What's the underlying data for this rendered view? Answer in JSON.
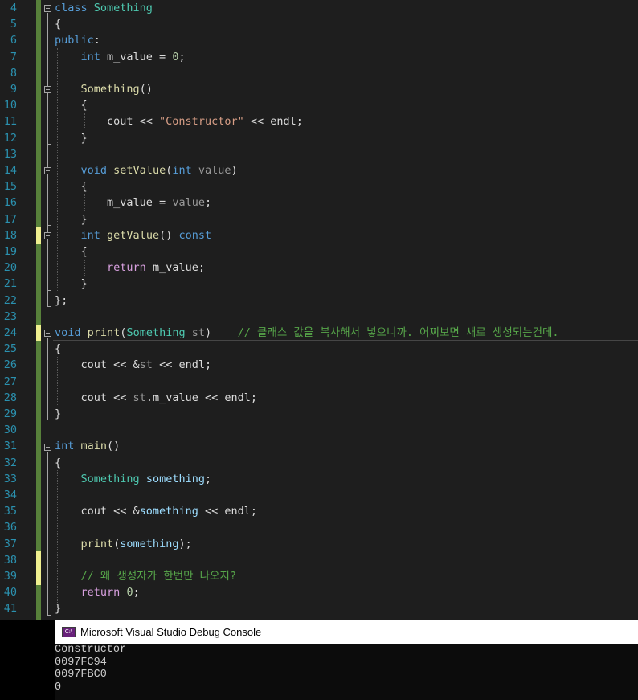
{
  "editor": {
    "line_numbers": [
      "4",
      "5",
      "6",
      "7",
      "8",
      "9",
      "10",
      "11",
      "12",
      "13",
      "14",
      "15",
      "16",
      "17",
      "18",
      "19",
      "20",
      "21",
      "22",
      "23",
      "24",
      "25",
      "26",
      "27",
      "28",
      "29",
      "30",
      "31",
      "32",
      "33",
      "34",
      "35",
      "36",
      "37",
      "38",
      "39",
      "40",
      "41"
    ],
    "code_lines": [
      [
        {
          "t": "class",
          "c": "kw"
        },
        {
          "t": " ",
          "c": "pl"
        },
        {
          "t": "Something",
          "c": "ty"
        }
      ],
      [
        {
          "t": "{",
          "c": "pl"
        }
      ],
      [
        {
          "t": "public",
          "c": "kw"
        },
        {
          "t": ":",
          "c": "pl"
        }
      ],
      [
        {
          "t": "    ",
          "c": "pl"
        },
        {
          "t": "int",
          "c": "kw"
        },
        {
          "t": " m_value = ",
          "c": "pl"
        },
        {
          "t": "0",
          "c": "num"
        },
        {
          "t": ";",
          "c": "pl"
        }
      ],
      [],
      [
        {
          "t": "    ",
          "c": "pl"
        },
        {
          "t": "Something",
          "c": "fn"
        },
        {
          "t": "()",
          "c": "pl"
        }
      ],
      [
        {
          "t": "    {",
          "c": "pl"
        }
      ],
      [
        {
          "t": "        cout << ",
          "c": "pl"
        },
        {
          "t": "\"Constructor\"",
          "c": "str"
        },
        {
          "t": " << endl;",
          "c": "pl"
        }
      ],
      [
        {
          "t": "    }",
          "c": "pl"
        }
      ],
      [],
      [
        {
          "t": "    ",
          "c": "pl"
        },
        {
          "t": "void",
          "c": "kw"
        },
        {
          "t": " ",
          "c": "pl"
        },
        {
          "t": "setValue",
          "c": "fn"
        },
        {
          "t": "(",
          "c": "pl"
        },
        {
          "t": "int",
          "c": "kw"
        },
        {
          "t": " ",
          "c": "pl"
        },
        {
          "t": "value",
          "c": "par"
        },
        {
          "t": ")",
          "c": "pl"
        }
      ],
      [
        {
          "t": "    {",
          "c": "pl"
        }
      ],
      [
        {
          "t": "        m_value = ",
          "c": "pl"
        },
        {
          "t": "value",
          "c": "par"
        },
        {
          "t": ";",
          "c": "pl"
        }
      ],
      [
        {
          "t": "    }",
          "c": "pl"
        }
      ],
      [
        {
          "t": "    ",
          "c": "pl"
        },
        {
          "t": "int",
          "c": "kw"
        },
        {
          "t": " ",
          "c": "pl"
        },
        {
          "t": "getValue",
          "c": "fn"
        },
        {
          "t": "() ",
          "c": "pl"
        },
        {
          "t": "const",
          "c": "kw"
        }
      ],
      [
        {
          "t": "    {",
          "c": "pl"
        }
      ],
      [
        {
          "t": "        ",
          "c": "pl"
        },
        {
          "t": "return",
          "c": "kwc"
        },
        {
          "t": " m_value;",
          "c": "pl"
        }
      ],
      [
        {
          "t": "    }",
          "c": "pl"
        }
      ],
      [
        {
          "t": "};",
          "c": "pl"
        }
      ],
      [],
      [
        {
          "t": "void",
          "c": "kw"
        },
        {
          "t": " ",
          "c": "pl"
        },
        {
          "t": "print",
          "c": "fn"
        },
        {
          "t": "(",
          "c": "pl"
        },
        {
          "t": "Something",
          "c": "ty"
        },
        {
          "t": " ",
          "c": "pl"
        },
        {
          "t": "st",
          "c": "par"
        },
        {
          "t": ")    ",
          "c": "pl"
        },
        {
          "t": "// 클래스 값을 복사해서 넣으니까. 어찌보면 새로 생성되는건데.",
          "c": "cm"
        }
      ],
      [
        {
          "t": "{",
          "c": "pl"
        }
      ],
      [
        {
          "t": "    cout << &",
          "c": "pl"
        },
        {
          "t": "st",
          "c": "par"
        },
        {
          "t": " << endl;",
          "c": "pl"
        }
      ],
      [],
      [
        {
          "t": "    cout << ",
          "c": "pl"
        },
        {
          "t": "st",
          "c": "par"
        },
        {
          "t": ".m_value << endl;",
          "c": "pl"
        }
      ],
      [
        {
          "t": "}",
          "c": "pl"
        }
      ],
      [],
      [
        {
          "t": "int",
          "c": "kw"
        },
        {
          "t": " ",
          "c": "pl"
        },
        {
          "t": "main",
          "c": "fn"
        },
        {
          "t": "()",
          "c": "pl"
        }
      ],
      [
        {
          "t": "{",
          "c": "pl"
        }
      ],
      [
        {
          "t": "    ",
          "c": "pl"
        },
        {
          "t": "Something",
          "c": "ty"
        },
        {
          "t": " ",
          "c": "pl"
        },
        {
          "t": "something",
          "c": "var"
        },
        {
          "t": ";",
          "c": "pl"
        }
      ],
      [],
      [
        {
          "t": "    cout << &",
          "c": "pl"
        },
        {
          "t": "something",
          "c": "var"
        },
        {
          "t": " << endl;",
          "c": "pl"
        }
      ],
      [],
      [
        {
          "t": "    ",
          "c": "pl"
        },
        {
          "t": "print",
          "c": "fn"
        },
        {
          "t": "(",
          "c": "pl"
        },
        {
          "t": "something",
          "c": "var"
        },
        {
          "t": ");",
          "c": "pl"
        }
      ],
      [],
      [
        {
          "t": "    ",
          "c": "pl"
        },
        {
          "t": "// 왜 생성자가 한번만 나오지?",
          "c": "cm"
        }
      ],
      [
        {
          "t": "    ",
          "c": "pl"
        },
        {
          "t": "return",
          "c": "kwc"
        },
        {
          "t": " ",
          "c": "pl"
        },
        {
          "t": "0",
          "c": "num"
        },
        {
          "t": ";",
          "c": "pl"
        }
      ],
      [
        {
          "t": "}",
          "c": "pl"
        }
      ]
    ],
    "colors": {
      "background": "#1e1e1e",
      "line_number": "#2b91af",
      "keyword": "#569cd6",
      "control_keyword": "#d8a0df",
      "type": "#4ec9b0",
      "function": "#dcdcaa",
      "string": "#d69d85",
      "number": "#b5cea8",
      "comment": "#57a64a",
      "change_saved": "#57803a",
      "change_unsaved": "#efef8f"
    }
  },
  "console": {
    "title": "Microsoft Visual Studio Debug Console",
    "icon": "console-app-icon",
    "output_lines": [
      "Constructor",
      "0097FC94",
      "0097FBC0",
      "0"
    ]
  }
}
